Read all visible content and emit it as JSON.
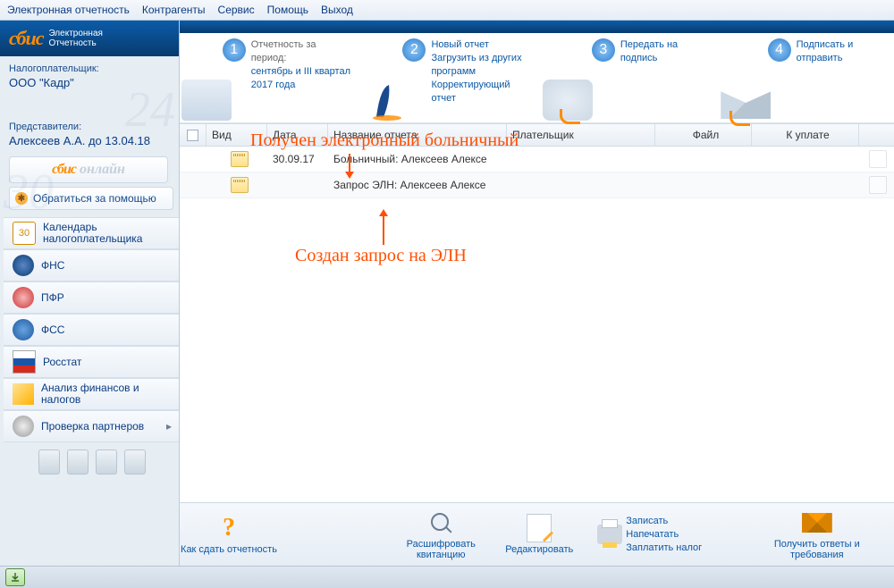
{
  "menu": {
    "m1": "Электронная отчетность",
    "m2": "Контрагенты",
    "m3": "Сервис",
    "m4": "Помощь",
    "m5": "Выход"
  },
  "brand": {
    "logo": "сбис",
    "sub1": "Электронная",
    "sub2": "Отчетность"
  },
  "taxpayer": {
    "label": "Налогоплательщик:",
    "value": "ООО \"Кадр\""
  },
  "rep": {
    "label": "Представители:",
    "value": "Алексеев А.А. до 13.04.18"
  },
  "sb": {
    "online1": "сбис",
    "online2": "онлайн",
    "help": "Обратиться за помощью"
  },
  "nav": {
    "n0": "Календарь налогоплательщика",
    "cal": "30",
    "n1": "ФНС",
    "n2": "ПФР",
    "n3": "ФСС",
    "n4": "Росстат",
    "n5": "Анализ финансов и налогов",
    "n6": "Проверка партнеров"
  },
  "steps": {
    "s1": {
      "num": "1",
      "t": "Отчетность за период:",
      "l": "сентябрь и III квартал 2017 года"
    },
    "s2": {
      "num": "2",
      "t": "Новый отчет",
      "l1": "Загрузить из других программ",
      "l2": "Корректирующий отчет"
    },
    "s3": {
      "num": "3",
      "t": "Передать на подпись"
    },
    "s4": {
      "num": "4",
      "t": "Подписать и отправить"
    }
  },
  "grid": {
    "h": {
      "vid": "Вид",
      "date": "Дата",
      "name": "Название отчета",
      "payer": "Плательщик",
      "file": "Файл",
      "pay": "К уплате"
    },
    "rows": [
      {
        "date": "30.09.17",
        "name": "Больничный: Алексеев Алексе"
      },
      {
        "date": "",
        "name": "Запрос ЭЛН: Алексеев Алексе"
      }
    ]
  },
  "notes": {
    "top": "Получен электронный больничный",
    "bot": "Создан запрос на ЭЛН"
  },
  "bb": {
    "howto": "Как сдать отчетность",
    "decrypt": "Расшифровать квитанцию",
    "edit": "Редактировать",
    "save": "Записать",
    "print": "Напечатать",
    "paytax": "Заплатить налог",
    "get": "Получить ответы и требования"
  }
}
